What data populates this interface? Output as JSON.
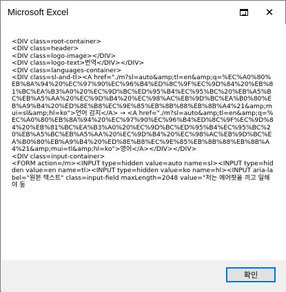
{
  "window": {
    "title": "Microsoft Excel",
    "close_glyph": "✕"
  },
  "message": {
    "text": "<DIV class=root-container>\n<DIV class=header>\n<DIV class=logo-image></DIV>\n<DIV class=logo-text>번역</DIV></DIV>\n<DIV class=languages-container>\n<DIV class=sl-and-tl><A href=\"./m?sl=auto&amp;tl=en&amp;q=%EC%A0%80%EB%8A%94%20%EC%97%90%EC%96%B4%ED%8C%9F%EC%9D%84%20%EB%81%BC%EA%B3%A0%20%EC%9D%BC%ED%95%B4%EC%95%BC%20%EB%A5%BC%EB%A5%AA%20%EC%9D%B4%20%EC%98%AC%EB%9D%BC%EA%B0%80%EB%A9%B4%20%ED%8E%B8%EC%9E%85%EB%8B%88%EB%8B%A4%21&amp;mui=sl&amp;hl=ko\">언어 감지</A> → <A href=\"./m?sl=auto&amp;tl=en&amp;q=%EC%A0%80%EB%8A%94%20%EC%97%90%EC%96%B4%ED%8C%9F%EC%9D%84%20%EB%81%BC%EA%B3%A0%20%EC%9D%BC%ED%95%B4%EC%95%BC%20%EB%A5%BC%EB%A5%AA%20%EC%9D%B4%20%EC%98%AC%EB%9D%BC%EA%B0%80%EB%A9%B4%20%ED%8E%B8%EC%9E%85%EB%8B%88%EB%8B%A4%21&amp;mui=tl&amp;hl=ko\">영어</A></DIV></DIV>\n<DIV class=input-container>\n<FORM action=/m><INPUT type=hidden value=auto name=sl><INPUT type=hidden value=en name=tl><INPUT type=hidden value=ko name=hl><INPUT aria-label=\"원본 텍스트\" class=input-field maxLength=2048 value=\"저는 에어팟을 끼고 일해야 둥"
  },
  "footer": {
    "ok_label": "확인"
  },
  "colors": {
    "accent": "#0078d7",
    "dialog_bg": "#f0f0f0"
  },
  "icons": [
    "restore-icon",
    "close-icon"
  ]
}
